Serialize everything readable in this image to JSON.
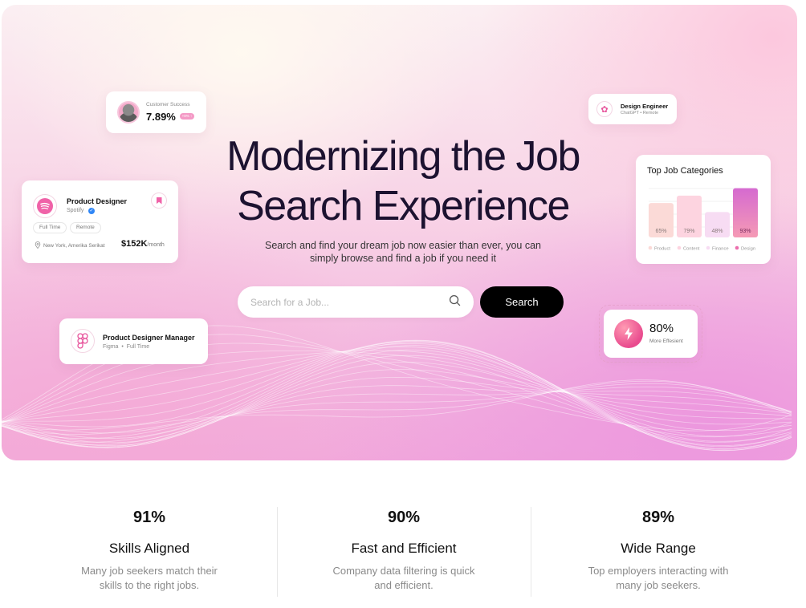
{
  "hero": {
    "headline_line1": "Modernizing the Job",
    "headline_line2": "Search Experience",
    "subline_line1": "Search and find your dream job now easier than ever, you can",
    "subline_line2": "simply browse and find a job if you need it"
  },
  "search": {
    "placeholder": "Search for a Job...",
    "value": "",
    "button_label": "Search"
  },
  "customer_success": {
    "label": "Customer Success",
    "value": "7.89%",
    "badge": "+8% ↑"
  },
  "product_designer": {
    "title": "Product Designer",
    "company": "Spotify",
    "tags": [
      "Full Time",
      "Remote"
    ],
    "location": "New York, Amerika Serikat",
    "salary": "$152K",
    "salary_unit": "/month"
  },
  "product_designer_manager": {
    "title": "Product Designer Manager",
    "company": "Figma",
    "type": "Full Time"
  },
  "design_engineer": {
    "title": "Design Engineer",
    "company": "ChatGPT",
    "type": "Remote"
  },
  "top_job_categories": {
    "title": "Top Job Categories"
  },
  "chart_data": {
    "type": "bar",
    "title": "Top Job Categories",
    "categories": [
      "Product",
      "Content",
      "Finance",
      "Design"
    ],
    "values": [
      65,
      79,
      48,
      93
    ],
    "labels": [
      "65%",
      "79%",
      "48%",
      "93%"
    ],
    "ylim": [
      0,
      100
    ],
    "colors": [
      "#fbdad7",
      "#fdd4e0",
      "#f7dcf3",
      "#ec6fae"
    ],
    "legend_position": "bottom"
  },
  "efficiency": {
    "value": "80%",
    "label": "More Effesient"
  },
  "stats": [
    {
      "percent": "91%",
      "title": "Skills Aligned",
      "desc": "Many job seekers match their skills to the right jobs."
    },
    {
      "percent": "90%",
      "title": "Fast and Efficient",
      "desc": "Company data filtering is quick and efficient."
    },
    {
      "percent": "89%",
      "title": "Wide Range",
      "desc": "Top employers interacting with many job seekers."
    }
  ]
}
